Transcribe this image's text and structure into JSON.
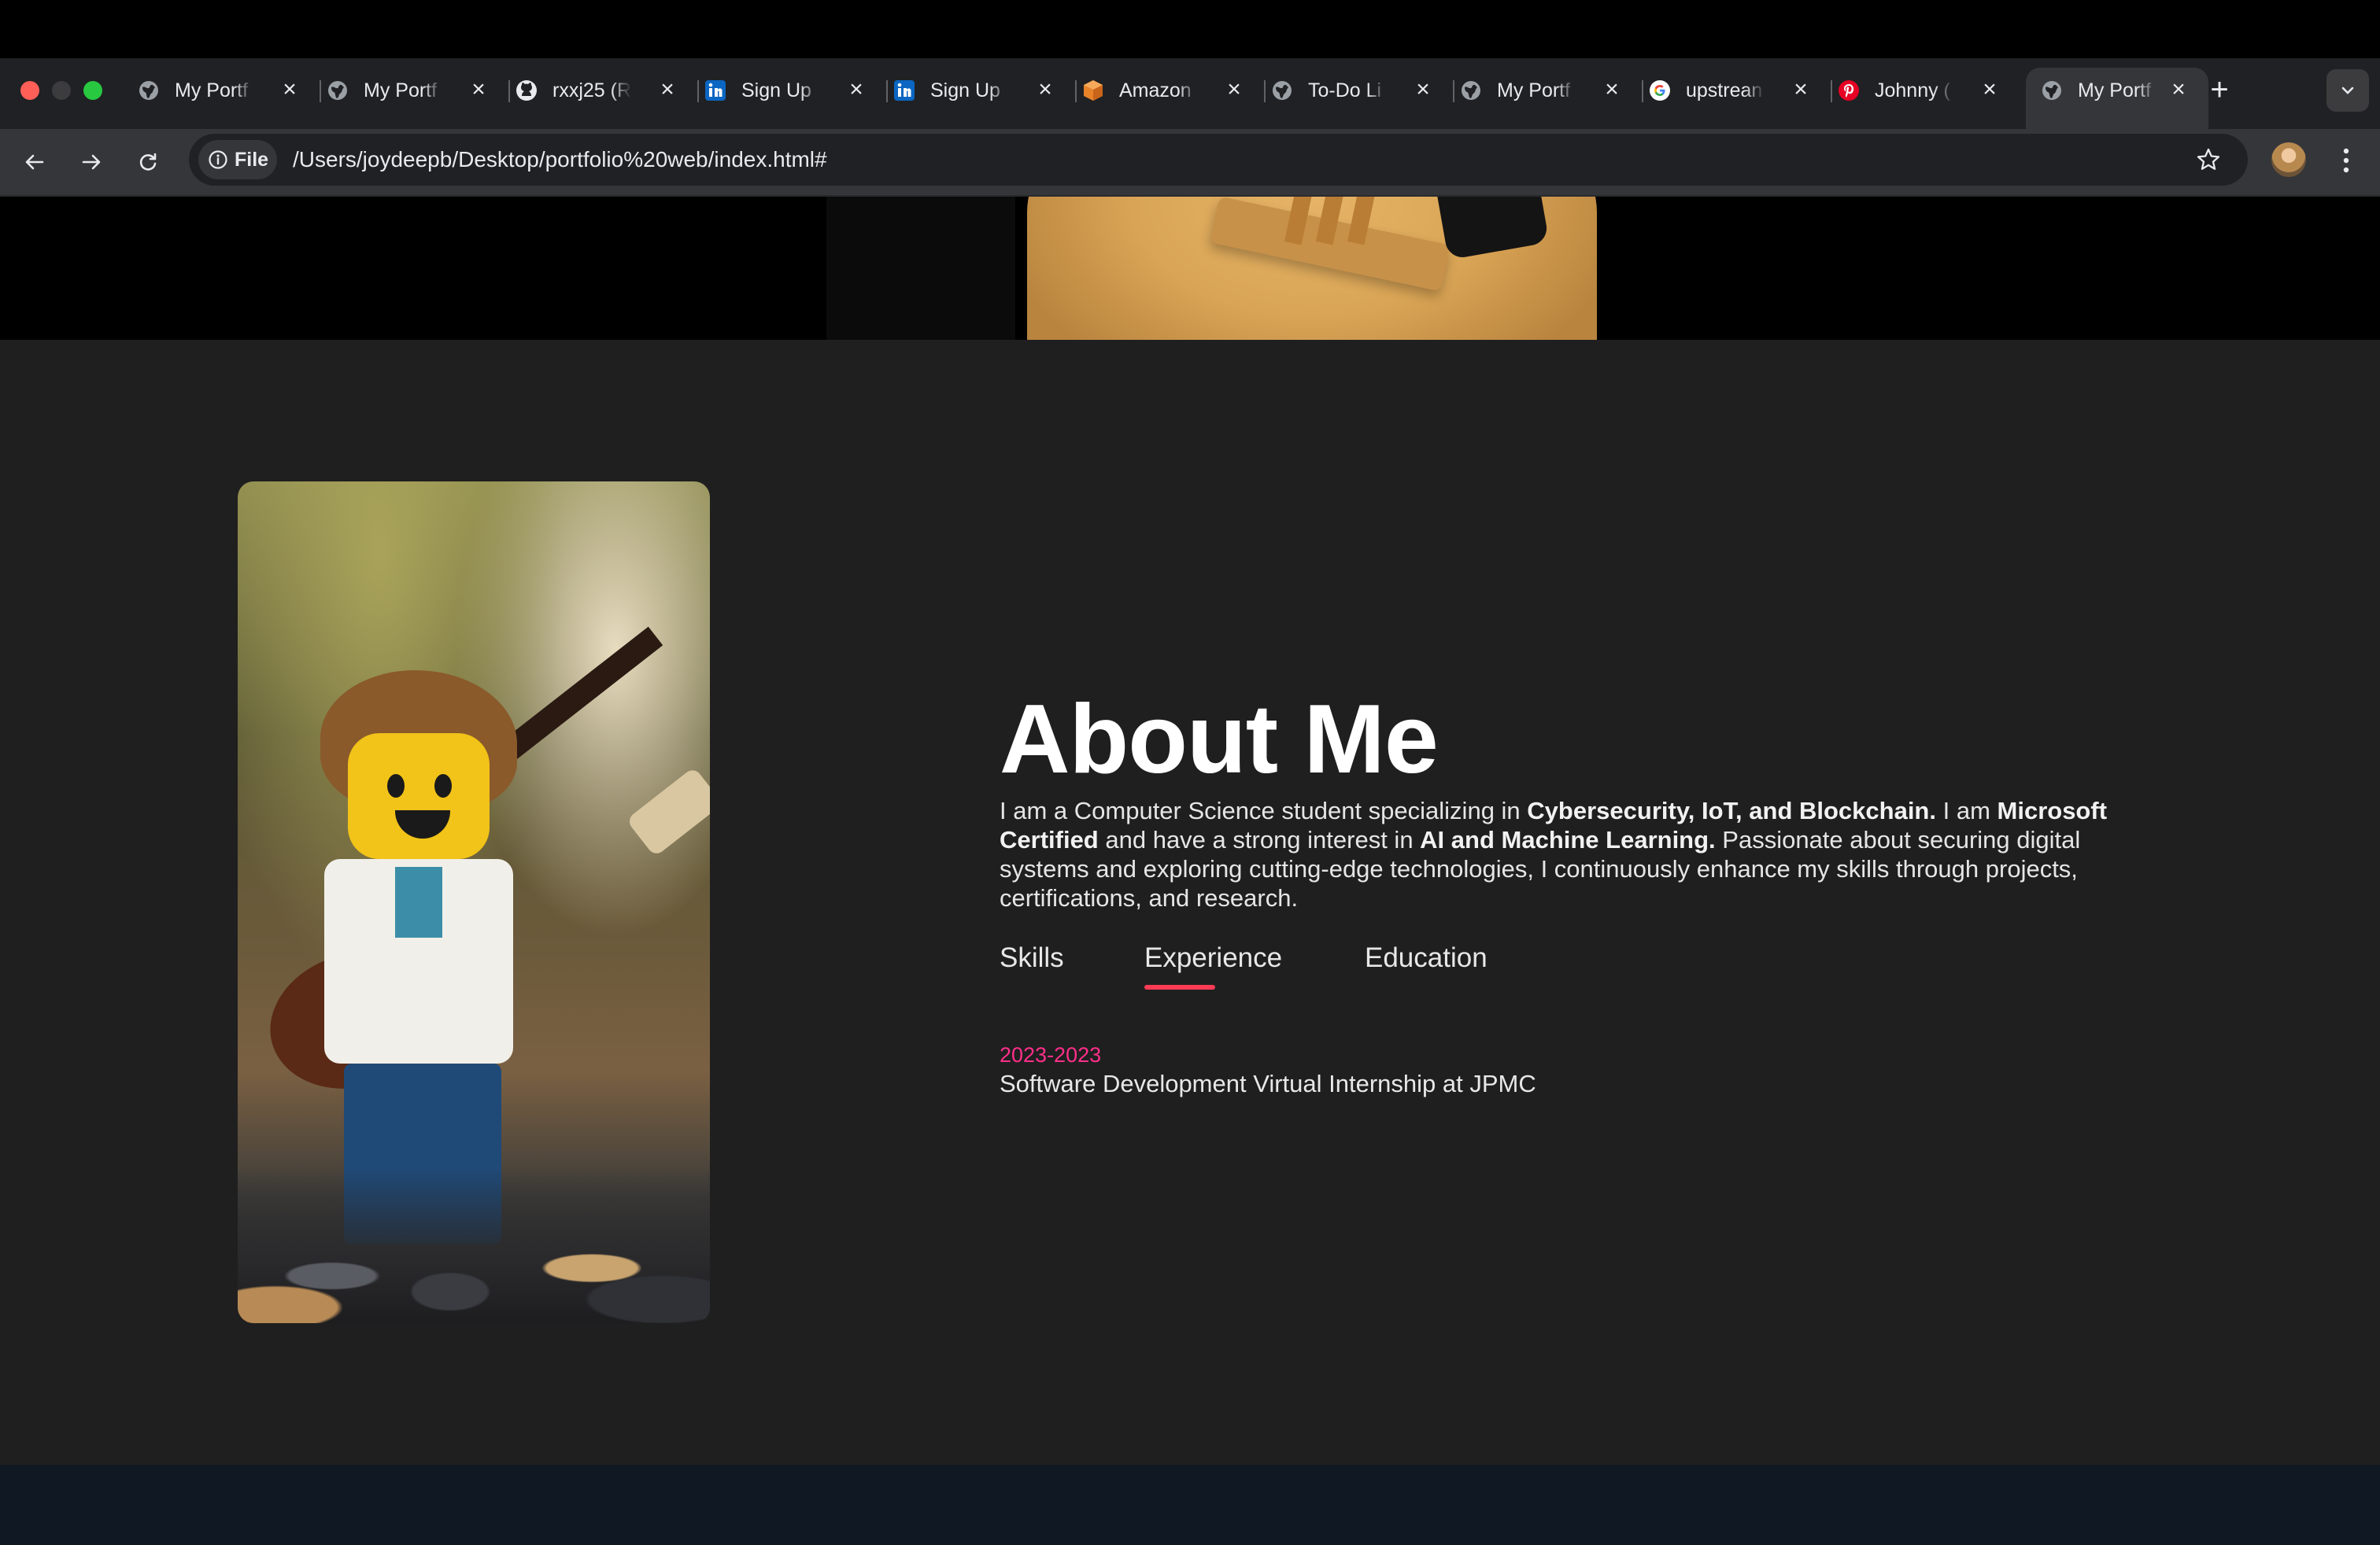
{
  "browser": {
    "tabs": [
      {
        "title": "My Portf",
        "icon": "globe-icon",
        "active": false
      },
      {
        "title": "My Portf",
        "icon": "globe-icon",
        "active": false
      },
      {
        "title": "rxxj25 (R",
        "icon": "github-icon",
        "active": false
      },
      {
        "title": "Sign Up",
        "icon": "linkedin-icon",
        "active": false
      },
      {
        "title": "Sign Up",
        "icon": "linkedin-icon",
        "active": false
      },
      {
        "title": "Amazon",
        "icon": "aws-cube-icon",
        "active": false
      },
      {
        "title": "To-Do Li",
        "icon": "globe-icon",
        "active": false
      },
      {
        "title": "My Portf",
        "icon": "globe-icon",
        "active": false
      },
      {
        "title": "upstrean",
        "icon": "google-icon",
        "active": false
      },
      {
        "title": "Johnny (",
        "icon": "pinterest-icon",
        "active": false
      },
      {
        "title": "My Portf",
        "icon": "globe-icon",
        "active": true
      }
    ],
    "address": {
      "chip_label": "File",
      "url": "/Users/joydeepb/Desktop/portfolio%20web/index.html#"
    }
  },
  "about": {
    "title": "About Me",
    "paragraph": [
      {
        "text": "I am a Computer Science student specializing in ",
        "bold": false
      },
      {
        "text": "Cybersecurity, IoT, and Blockchain.",
        "bold": true
      },
      {
        "text": " I am ",
        "bold": false
      },
      {
        "text": "Microsoft Certified",
        "bold": true
      },
      {
        "text": " and have a strong interest in ",
        "bold": false
      },
      {
        "text": "AI and Machine Learning.",
        "bold": true
      },
      {
        "text": " Passionate about securing digital systems and exploring cutting-edge technologies, I continuously enhance my skills through projects, certifications, and research.",
        "bold": false
      }
    ],
    "tabs": [
      "Skills",
      "Experience",
      "Education"
    ],
    "active_tab": "Experience",
    "experience": [
      {
        "year": "2023-2023",
        "role": "Software Development Virtual Internship at JPMC"
      }
    ]
  },
  "colors": {
    "accent": "#ff3b55",
    "year": "#ff2f8a",
    "page_bg": "#1f1f1f"
  }
}
